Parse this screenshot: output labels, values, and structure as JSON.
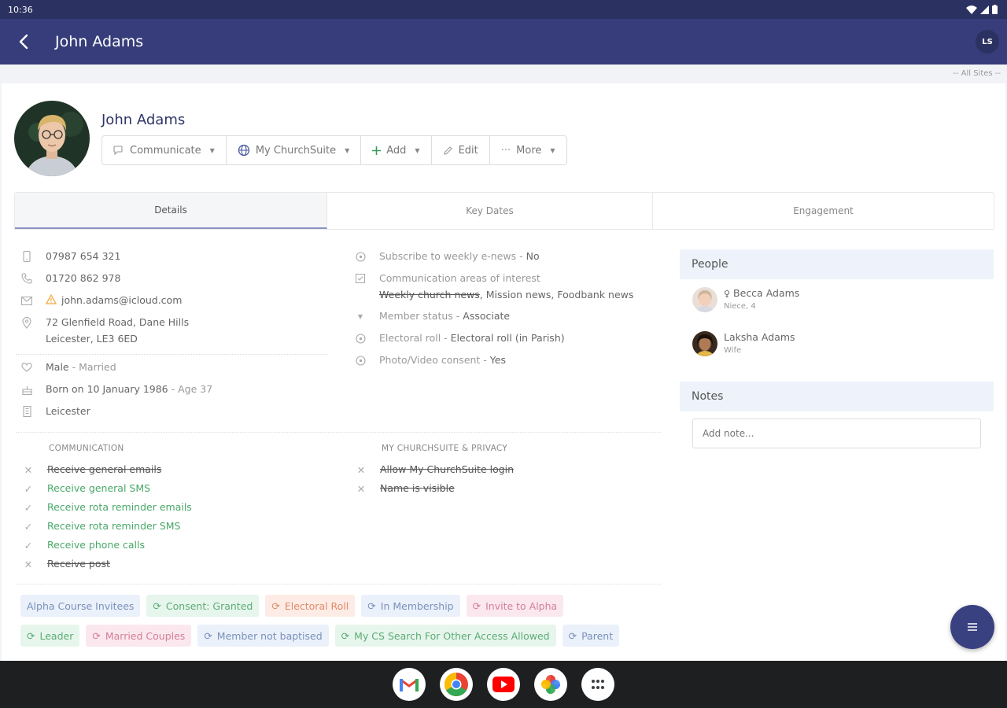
{
  "status": {
    "time": "10:36"
  },
  "appbar": {
    "title": "John Adams",
    "user_initials": "LS"
  },
  "sites_label": "-- All Sites --",
  "profile": {
    "name": "John Adams",
    "actions": [
      "Communicate",
      "My ChurchSuite",
      "Add",
      "Edit",
      "More"
    ]
  },
  "tabs": [
    "Details",
    "Key Dates",
    "Engagement"
  ],
  "contact": {
    "mobile": "07987 654 321",
    "phone": "01720 862 978",
    "email": "john.adams@icloud.com",
    "address_line1": "72 Glenfield Road, Dane Hills",
    "address_line2": "Leicester, LE3 6ED",
    "sex": "Male",
    "marital": "Married",
    "born": "Born on 10 January 1986",
    "age": "Age 37",
    "site": "Leicester"
  },
  "preferences": {
    "weekly_label": "Subscribe to weekly e-news - ",
    "weekly_value": "No",
    "areas_label": "Communication areas of interest",
    "areas_struck": "Weekly church news",
    "areas_rest": ", Mission news, Foodbank news",
    "member_label": "Member status - ",
    "member_value": "Associate",
    "electoral_label": "Electoral roll - ",
    "electoral_value": "Electoral roll (in Parish)",
    "photo_label": "Photo/Video consent - ",
    "photo_value": "Yes"
  },
  "communication": {
    "title": "COMMUNICATION",
    "items": [
      {
        "label": "Receive general emails"
      },
      {
        "label": "Receive general SMS"
      },
      {
        "label": "Receive rota reminder emails"
      },
      {
        "label": "Receive rota reminder SMS"
      },
      {
        "label": "Receive phone calls"
      },
      {
        "label": "Receive post"
      }
    ]
  },
  "privacy": {
    "title": "MY CHURCHSUITE & PRIVACY",
    "items": [
      {
        "label": "Allow My ChurchSuite login"
      },
      {
        "label": "Name is visible"
      }
    ]
  },
  "people": {
    "title": "People",
    "items": [
      {
        "name": "Becca Adams",
        "relation": "Niece, 4"
      },
      {
        "name": "Laksha Adams",
        "relation": "Wife"
      }
    ]
  },
  "notes": {
    "title": "Notes",
    "placeholder": "Add note..."
  },
  "tags": [
    {
      "label": "Alpha Course Invitees",
      "color": "blue"
    },
    {
      "label": "Consent: Granted",
      "color": "green"
    },
    {
      "label": "Electoral Roll",
      "color": "orange"
    },
    {
      "label": "In Membership",
      "color": "blue"
    },
    {
      "label": "Invite to Alpha",
      "color": "pink"
    },
    {
      "label": "Leader",
      "color": "green"
    },
    {
      "label": "Married Couples",
      "color": "pink"
    },
    {
      "label": "Member not baptised",
      "color": "blue"
    },
    {
      "label": "My CS Search For Other Access Allowed",
      "color": "green"
    },
    {
      "label": "Parent",
      "color": "blue"
    }
  ],
  "dock": [
    "Gmail",
    "Chrome",
    "YouTube",
    "Photos",
    "Apps"
  ]
}
